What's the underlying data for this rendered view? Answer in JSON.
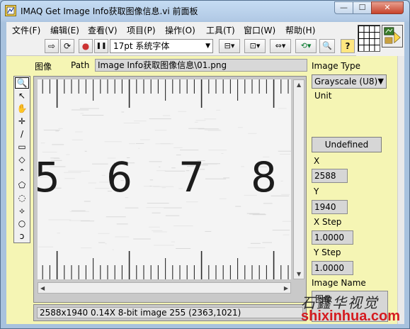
{
  "window": {
    "title": "IMAQ Get Image Info获取图像信息.vi 前面板",
    "min_glyph": "—",
    "max_glyph": "☐",
    "close_glyph": "✕"
  },
  "menu": {
    "items": [
      "文件(F)",
      "编辑(E)",
      "查看(V)",
      "项目(P)",
      "操作(O)",
      "工具(T)",
      "窗口(W)",
      "帮助(H)"
    ]
  },
  "toolbar": {
    "run_glyph": "⇨",
    "run_continuous_glyph": "⟳",
    "abort_glyph": "●",
    "pause_glyph": "❚❚",
    "font_label": "17pt 系统字体",
    "font_arrow": "▼",
    "align_glyph": "⊟▾",
    "distribute_glyph": "⊡▾",
    "resize_glyph": "⇔▾",
    "reorder_glyph": "⟲▾",
    "search_glyph": "🔍",
    "help_glyph": "?"
  },
  "panel": {
    "tab_image": "图像",
    "tab_path": "Path",
    "path_value": "Image Info获取图像信息\\01.png",
    "status_text": "2588x1940 0.14X 8-bit image 255      (2363,1021)",
    "ruler_digits": [
      "5",
      "6",
      "7",
      "8"
    ]
  },
  "tools": [
    "🔍",
    "↖",
    "✋",
    "✛",
    "/",
    "▭",
    "◇",
    "⌃",
    "⬠",
    "◌",
    "⟡",
    "○",
    "ↄ"
  ],
  "properties": {
    "image_type_label": "Image Type",
    "image_type_value": "Grayscale (U8)",
    "unit_label": "Unit",
    "unit_value": "Undefined",
    "x_label": "X",
    "x_value": "2588",
    "y_label": "Y",
    "y_value": "1940",
    "x_step_label": "X Step",
    "x_step_value": "1.0000",
    "y_step_label": "Y Step",
    "y_step_value": "1.0000",
    "image_name_label": "Image Name",
    "image_name_value": "图像"
  },
  "watermark": {
    "calligraphy": "石鑫华视觉",
    "url": "shixinhua.com"
  }
}
